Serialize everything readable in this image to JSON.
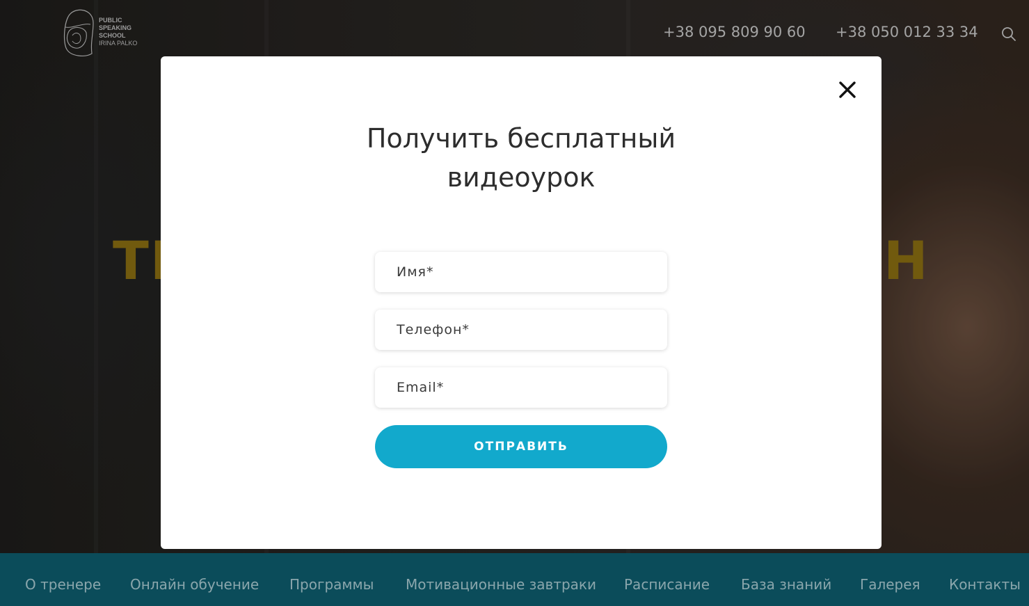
{
  "header": {
    "logo": {
      "line1": "PUBLIC",
      "line2": "SPEAKING",
      "line3": "SCHOOL",
      "line4": "IRINA PALKO"
    },
    "phones": [
      "+38 095 809 90 60",
      "+38 050 012 33 34"
    ],
    "search_icon": "search-icon"
  },
  "hero": {
    "partial_text_left": "ТI",
    "partial_text_right": "Н",
    "accent_color": "#8a6e12"
  },
  "modal": {
    "title_line1": "Получить бесплатный",
    "title_line2": "видеоурок",
    "close_icon": "close-icon",
    "fields": {
      "name_placeholder": "Имя*",
      "phone_placeholder": "Телефон*",
      "email_placeholder": "Email*"
    },
    "submit_label": "ОТПРАВИТЬ",
    "button_color": "#12a9cc"
  },
  "bottom_nav": {
    "background": "#0e5d6e",
    "items": [
      "О тренере",
      "Онлайн обучение",
      "Программы",
      "Мотивационные завтраки",
      "Расписание",
      "База знаний",
      "Галерея",
      "Контакты"
    ]
  }
}
